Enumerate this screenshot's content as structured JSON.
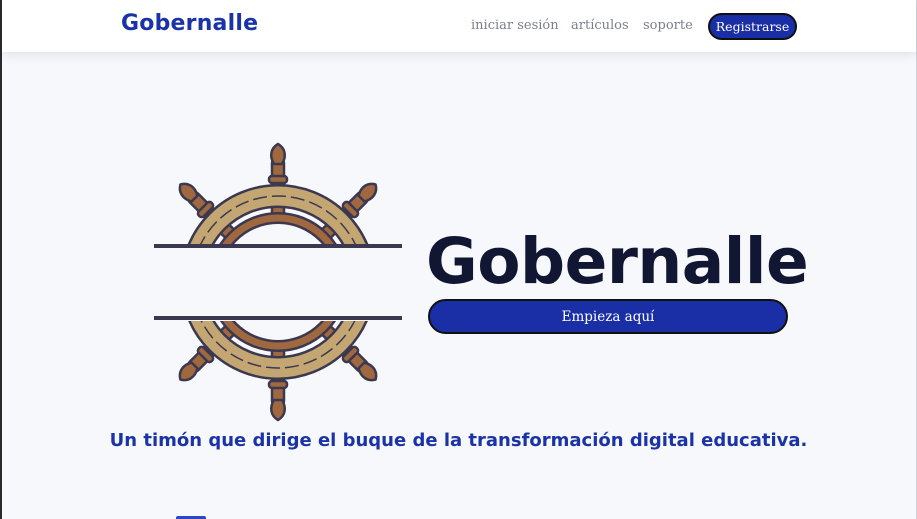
{
  "navbar": {
    "brand": "Gobernalle",
    "links": {
      "login": "iniciar sesión",
      "articles": "artículos",
      "support": "soporte"
    },
    "register_label": "Registrarse"
  },
  "hero": {
    "logo_icon": "ship-wheel-icon",
    "title": "Gobernalle",
    "cta_label": "Empieza aquí",
    "tagline": "Un timón que dirige el buque de la transformación digital educativa."
  },
  "colors": {
    "brand_blue": "#1a33a6",
    "button_blue": "#1a2ea6",
    "title_dark": "#111633",
    "nav_gray": "#7a7f8c",
    "wheel_wood": "#a0683f",
    "wheel_gold": "#c4a672",
    "outline": "#3b3850"
  }
}
